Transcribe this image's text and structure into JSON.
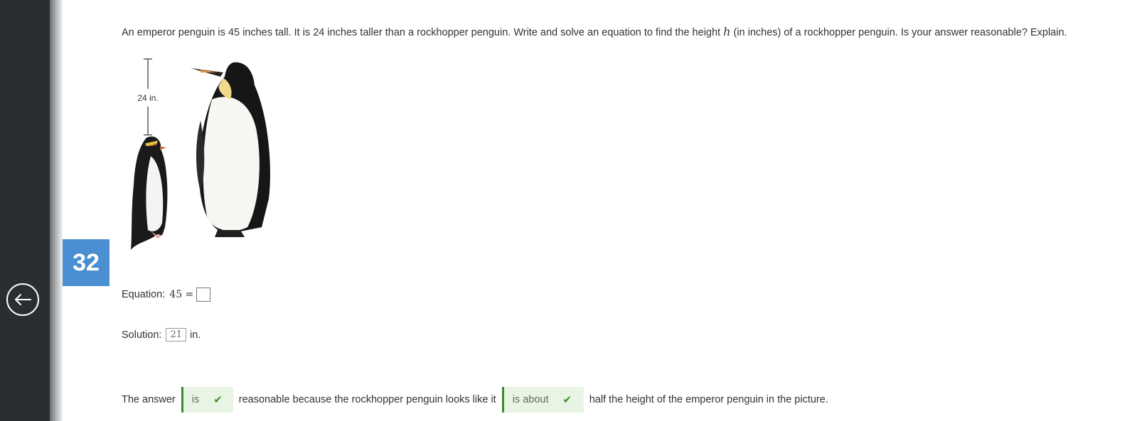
{
  "question_number": "32",
  "question": {
    "part1": "An emperor penguin is 45 inches tall. It is 24 inches taller than a rockhopper penguin. Write and solve an equation to find the height",
    "variable": "h",
    "part2": "(in inches) of a rockhopper penguin. Is your answer reasonable? Explain."
  },
  "figure": {
    "measure_label": "24 in."
  },
  "equation": {
    "label": "Equation:",
    "lhs": "45 =",
    "value": ""
  },
  "solution": {
    "label": "Solution:",
    "value": "21",
    "unit": "in."
  },
  "answer": {
    "prefix": "The answer",
    "choice1": "is",
    "middle": "reasonable because the rockhopper penguin looks like it",
    "choice2": "is about",
    "suffix": "half the height of the emperor penguin in the picture."
  },
  "colors": {
    "sidebar": "#2b2e30",
    "badge": "#4a8fd1",
    "correct": "#3d8a2a",
    "correct_bg": "#e9f5e4"
  },
  "icons": {
    "back": "arrow-left-circle-icon",
    "check": "check-icon"
  }
}
